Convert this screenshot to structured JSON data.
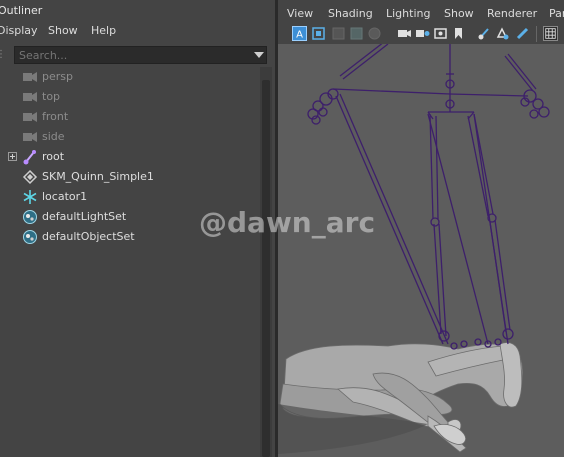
{
  "outliner": {
    "title": "Outliner",
    "menu": [
      "Display",
      "Show",
      "Help"
    ],
    "search": {
      "placeholder": "Search..."
    },
    "items": [
      {
        "label": "persp",
        "icon": "camera-icon",
        "dim": true
      },
      {
        "label": "top",
        "icon": "camera-icon",
        "dim": true
      },
      {
        "label": "front",
        "icon": "camera-icon",
        "dim": true
      },
      {
        "label": "side",
        "icon": "camera-icon",
        "dim": true
      },
      {
        "label": "root",
        "icon": "joint-icon",
        "dim": false,
        "expandable": true
      },
      {
        "label": "SKM_Quinn_Simple1",
        "icon": "mesh-icon",
        "dim": false
      },
      {
        "label": "locator1",
        "icon": "locator-icon",
        "dim": false
      },
      {
        "label": "defaultLightSet",
        "icon": "set-icon",
        "dim": false
      },
      {
        "label": "defaultObjectSet",
        "icon": "set-icon",
        "dim": false
      }
    ]
  },
  "viewport": {
    "menu": [
      "View",
      "Shading",
      "Lighting",
      "Show",
      "Renderer",
      "Par"
    ],
    "toolbar_icons": [
      "select-camera-icon",
      "camera-attributes-icon",
      "bookmark-icon",
      "image-plane-icon",
      "grid-icon",
      "film-gate-icon",
      "resolution-gate-icon",
      "gate-mask-icon",
      "field-chart-icon",
      "safe-action-icon",
      "pan-zoom-icon",
      "grease-pencil-icon",
      "wireframe-icon"
    ],
    "watermark": "@dawn_arc",
    "colors": {
      "skeleton": "#3d1f6b",
      "joint": "#4b2a80",
      "mesh": "#a8a8a8",
      "background": "#5d5d5d"
    }
  }
}
